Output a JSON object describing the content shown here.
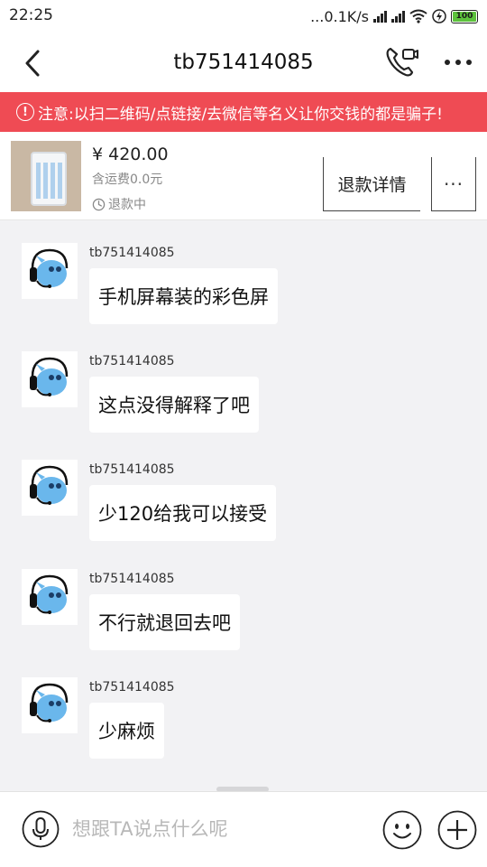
{
  "status_bar": {
    "time": "22:25",
    "network_speed": "...0.1K/s",
    "battery_level": "100",
    "battery_color": "#5cc23c"
  },
  "nav": {
    "title": "tb751414085",
    "back_icon": "chevron-left-icon",
    "call_icon": "phone-video-icon",
    "more_icon": "more-dots-icon"
  },
  "warning": {
    "icon": "!",
    "text": "注意:以扫二维码/点链接/去微信等名义让你交钱的都是骗子!",
    "color": "#ef4b54"
  },
  "item": {
    "price": "¥ 420.00",
    "shipping": "含运费0.0元",
    "status": "退款中",
    "refund_button_label": "退款详情",
    "more_button_label": "···"
  },
  "messages": [
    {
      "sender": "tb751414085",
      "text": "手机屏幕装的彩色屏"
    },
    {
      "sender": "tb751414085",
      "text": "这点没得解释了吧"
    },
    {
      "sender": "tb751414085",
      "text": "少120给我可以接受"
    },
    {
      "sender": "tb751414085",
      "text": "不行就退回去吧"
    },
    {
      "sender": "tb751414085",
      "text": "少麻烦"
    }
  ],
  "input_bar": {
    "placeholder": "想跟TA说点什么呢",
    "value": ""
  }
}
